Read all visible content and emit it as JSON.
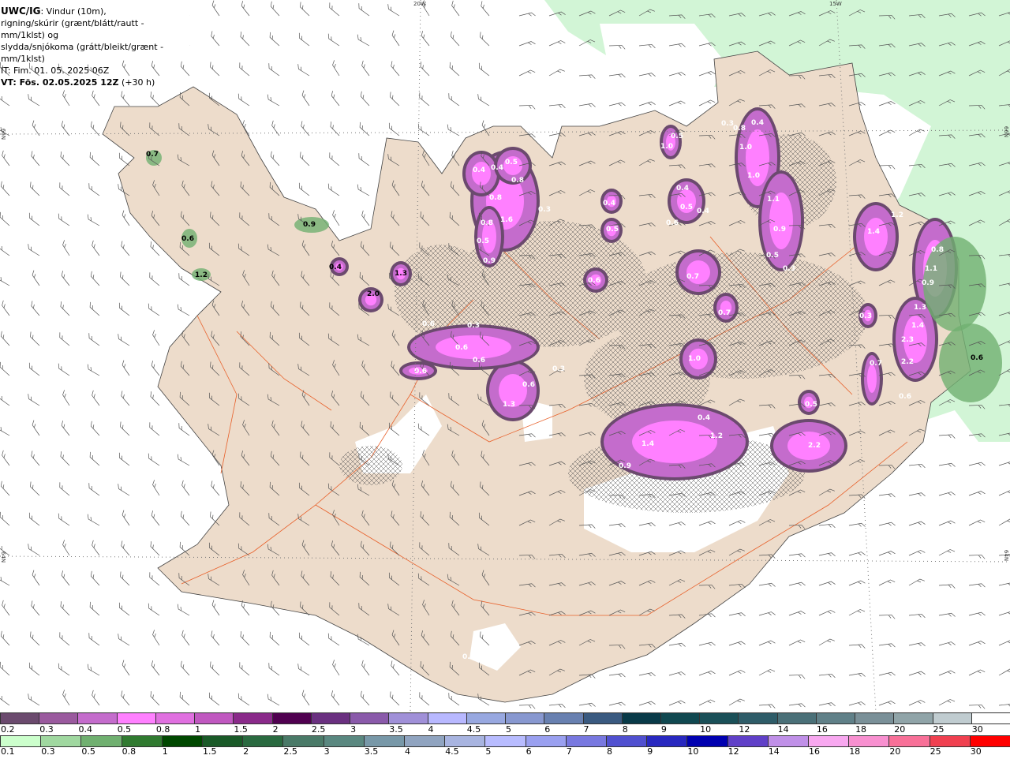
{
  "header": {
    "model": "UWC/IG",
    "line1": ": Vindur (10m),",
    "line2": "rigning/skúrir (grænt/blátt/rautt - mm/1klst) og",
    "line3": "slydda/snjókoma (grátt/bleikt/grænt - mm/1klst)",
    "it": "IT: Fim. 01. 05. 2025 06Z",
    "vt_bold": "VT: Fös. 02.05.2025 12Z",
    "vt_lead": "(+30 h)"
  },
  "grid_labels": {
    "lon_20w": "20W",
    "lon_15w": "15W",
    "lat_66n": "66N",
    "lat_64n": "64N"
  },
  "colors": {
    "sea": "#ffffff",
    "land": "#eddccb",
    "roads": "#e8602a",
    "light_green": "#d2f5d6"
  },
  "precip_labels": [
    "0.7",
    "0.6",
    "1.2",
    "0.9",
    "0.4",
    "2.0",
    "1.3",
    "0.4",
    "0.4",
    "0.5",
    "0.8",
    "0.8",
    "1.6",
    "0.8",
    "0.5",
    "0.9",
    "0.3",
    "0.4",
    "0.5",
    "0.6",
    "0.6",
    "0.3",
    "0.6",
    "0.6",
    "0.6",
    "0.6",
    "0.3",
    "1.3",
    "1.0",
    "0.5",
    "0.4",
    "0.5",
    "0.4",
    "0.6",
    "0.7",
    "0.7",
    "1.0",
    "0.4",
    "1.4",
    "1.2",
    "0.9",
    "2.2",
    "0.5",
    "1.0",
    "1.0",
    "1.1",
    "0.9",
    "0.5",
    "0.3",
    "0.3",
    "0.8",
    "0.4",
    "1.4",
    "1.2",
    "0.8",
    "1.1",
    "0.9",
    "1.3",
    "1.4",
    "2.3",
    "2.2",
    "0.7",
    "0.3",
    "0.6",
    "0.6",
    "0.4"
  ],
  "legend_snow": {
    "labels": [
      "0.2",
      "0.3",
      "0.4",
      "0.5",
      "0.8",
      "1",
      "1.5",
      "2",
      "2.5",
      "3",
      "3.5",
      "4",
      "4.5",
      "5",
      "6",
      "7",
      "8",
      "9",
      "10",
      "12",
      "14",
      "16",
      "18",
      "20",
      "25",
      "30"
    ],
    "colors": [
      "#6b4a6e",
      "#9a5a9e",
      "#c46ccc",
      "#ff80ff",
      "#e070e0",
      "#c058c0",
      "#8a2a8a",
      "#500050",
      "#6a3080",
      "#8a5aaa",
      "#a090d8",
      "#b8b8ff",
      "#98a8e0",
      "#8898d0",
      "#6880b0",
      "#3a5a80",
      "#083a48",
      "#104850",
      "#1a5058",
      "#2e5c68",
      "#4a7078",
      "#608088",
      "#7a9098",
      "#90a4a8",
      "#c0ccd0",
      "#ffffff"
    ]
  },
  "legend_rain": {
    "labels": [
      "0.1",
      "0.3",
      "0.5",
      "0.8",
      "1",
      "1.5",
      "2",
      "2.5",
      "3",
      "3.5",
      "4",
      "4.5",
      "5",
      "6",
      "7",
      "8",
      "9",
      "10",
      "12",
      "14",
      "16",
      "18",
      "20",
      "25",
      "30"
    ],
    "colors": [
      "#ccffcc",
      "#a0d8a0",
      "#70b070",
      "#307a30",
      "#004800",
      "#1a5a28",
      "#2a6a40",
      "#4a7a68",
      "#5a8880",
      "#7898a8",
      "#90a4c0",
      "#a8b4e0",
      "#b8bcff",
      "#9aa0f0",
      "#7878e0",
      "#5050d0",
      "#2828c0",
      "#0000b0",
      "#6040c8",
      "#c090e8",
      "#f8a8f0",
      "#f890d0",
      "#f87098",
      "#f04050",
      "#ff0000"
    ]
  }
}
